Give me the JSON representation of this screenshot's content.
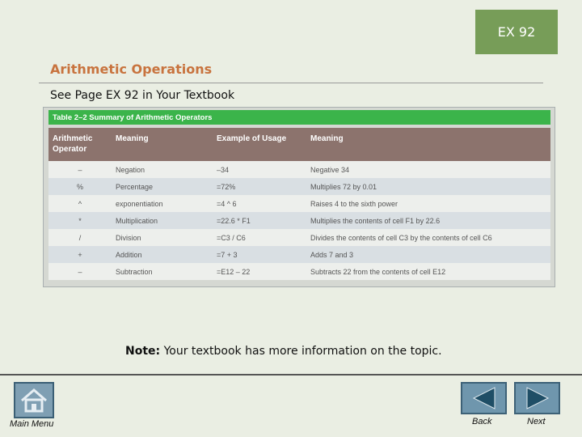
{
  "badge": "EX 92",
  "title": "Arithmetic Operations",
  "subtitle": "See Page EX 92 in Your Textbook",
  "table": {
    "caption": "Table 2–2 Summary of Arithmetic Operators",
    "headers": [
      "Arithmetic Operator",
      "Meaning",
      "Example of Usage",
      "Meaning"
    ],
    "rows": [
      [
        "–",
        "Negation",
        "–34",
        "Negative 34"
      ],
      [
        "%",
        "Percentage",
        "=72%",
        "Multiplies 72 by 0.01"
      ],
      [
        "^",
        "exponentiation",
        "=4 ^ 6",
        "Raises 4 to the sixth power"
      ],
      [
        "*",
        "Multiplication",
        "=22.6 * F1",
        "Multiplies the contents of cell F1 by 22.6"
      ],
      [
        "/",
        "Division",
        "=C3 / C6",
        "Divides the contents of cell C3 by the contents of cell C6"
      ],
      [
        "+",
        "Addition",
        "=7 + 3",
        "Adds 7 and 3"
      ],
      [
        "–",
        "Subtraction",
        "=E12 – 22",
        "Subtracts 22 from the contents of cell E12"
      ]
    ]
  },
  "note": {
    "label": "Note:",
    "text": " Your textbook has more information on the topic."
  },
  "footer": {
    "main_menu": "Main Menu",
    "back": "Back",
    "next": "Next"
  },
  "colors": {
    "badge": "#779d58",
    "title": "#c8733e",
    "caption": "#3bb44a",
    "header": "#8c736d",
    "nav_button": "#6f96ad"
  },
  "icons": {
    "home": "home-icon",
    "back": "left-arrow-icon",
    "next": "right-arrow-icon"
  }
}
